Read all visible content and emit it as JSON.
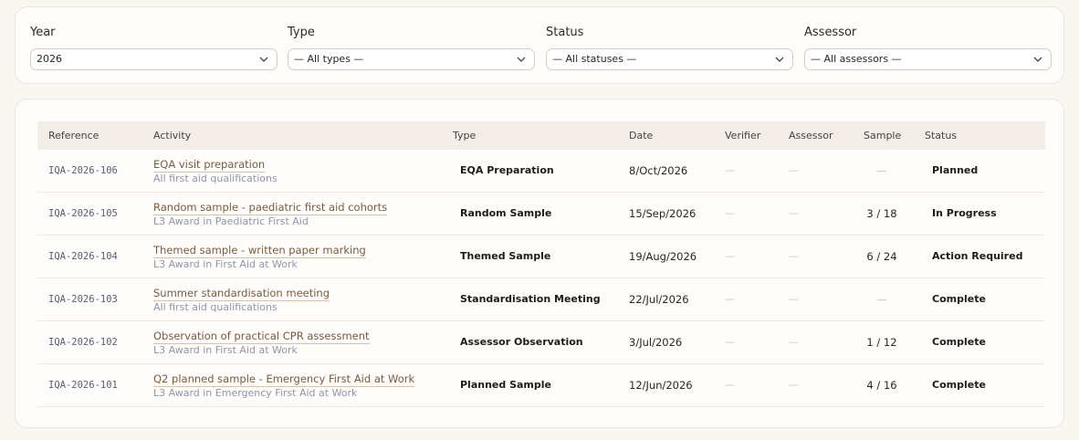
{
  "filters": {
    "year": {
      "label": "Year",
      "value": "2026"
    },
    "type": {
      "label": "Type",
      "value": "— All types —"
    },
    "status": {
      "label": "Status",
      "value": "— All statuses —"
    },
    "assessor": {
      "label": "Assessor",
      "value": "— All assessors —"
    }
  },
  "table": {
    "headers": {
      "reference": "Reference",
      "activity": "Activity",
      "type": "Type",
      "date": "Date",
      "verifier": "Verifier",
      "assessor": "Assessor",
      "sample": "Sample",
      "status": "Status"
    },
    "empty_mark": "—",
    "rows": [
      {
        "reference": "IQA-2026-106",
        "title": "EQA visit preparation",
        "qualification": "All first aid qualifications",
        "type": "EQA Preparation",
        "date": "8/Oct/2026",
        "verifier": "—",
        "assessor": "—",
        "sample": "—",
        "status": "Planned"
      },
      {
        "reference": "IQA-2026-105",
        "title": "Random sample - paediatric first aid cohorts",
        "qualification": "L3 Award in Paediatric First Aid",
        "type": "Random Sample",
        "date": "15/Sep/2026",
        "verifier": "—",
        "assessor": "—",
        "sample": "3 / 18",
        "status": "In Progress"
      },
      {
        "reference": "IQA-2026-104",
        "title": "Themed sample - written paper marking",
        "qualification": "L3 Award in First Aid at Work",
        "type": "Themed Sample",
        "date": "19/Aug/2026",
        "verifier": "—",
        "assessor": "—",
        "sample": "6 / 24",
        "status": "Action Required"
      },
      {
        "reference": "IQA-2026-103",
        "title": "Summer standardisation meeting",
        "qualification": "All first aid qualifications",
        "type": "Standardisation Meeting",
        "date": "22/Jul/2026",
        "verifier": "—",
        "assessor": "—",
        "sample": "—",
        "status": "Complete"
      },
      {
        "reference": "IQA-2026-102",
        "title": "Observation of practical CPR assessment",
        "qualification": "L3 Award in First Aid at Work",
        "type": "Assessor Observation",
        "date": "3/Jul/2026",
        "verifier": "—",
        "assessor": "—",
        "sample": "1 / 12",
        "status": "Complete"
      },
      {
        "reference": "IQA-2026-101",
        "title": "Q2 planned sample - Emergency First Aid at Work",
        "qualification": "L3 Award in Emergency First Aid at Work",
        "type": "Planned Sample",
        "date": "12/Jun/2026",
        "verifier": "—",
        "assessor": "—",
        "sample": "4 / 16",
        "status": "Complete"
      }
    ]
  },
  "icons": {
    "select_arrow": "chevron-down-icon"
  },
  "colors": {
    "link": "#7a5a3c",
    "subtext": "#8e96a8",
    "header_bg": "#f2ede6",
    "page_bg": "#faf7f2"
  }
}
